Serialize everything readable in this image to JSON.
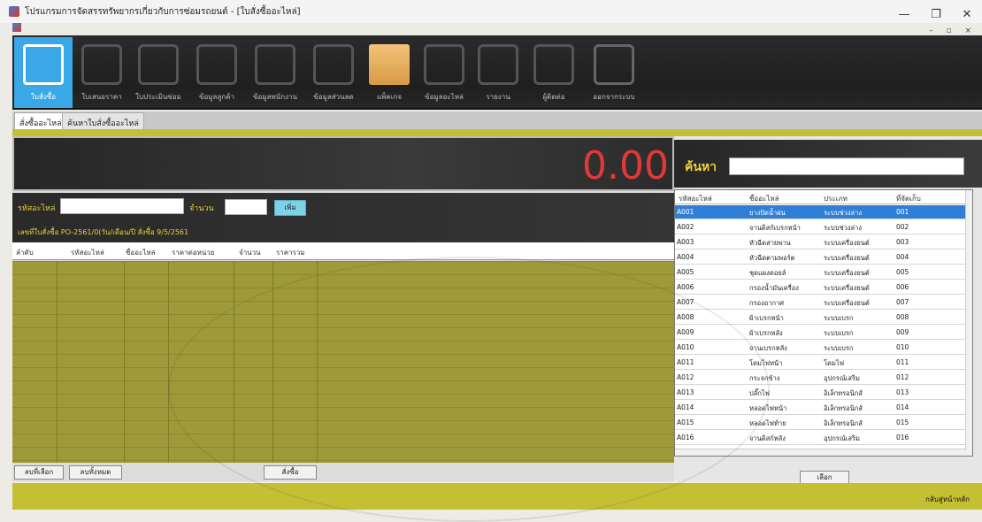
{
  "window": {
    "title": "โปรแกรมการจัดสรรทรัพยากรเกี่ยวกับการซ่อมรถยนต์ - [ใบสั่งซื้ออะไหล่]",
    "minimize": "—",
    "maximize": "❐",
    "close": "✕",
    "mdi_controls": "– ▫ ×"
  },
  "toolbar": {
    "items": [
      {
        "label": "ใบสั่งซื้อ",
        "icon": "calendar-check-icon"
      },
      {
        "label": "ใบเสนอราคา",
        "icon": "document-hand-icon"
      },
      {
        "label": "ใบประเมินซ่อม",
        "icon": "car-repair-icon"
      },
      {
        "label": "ข้อมูลลูกค้า",
        "icon": "customer-icon"
      },
      {
        "label": "ข้อมูลพนักงาน",
        "icon": "employee-card-icon"
      },
      {
        "label": "ข้อมูลส่วนลด",
        "icon": "sale-tag-icon"
      },
      {
        "label": "แพ็คเกจ",
        "icon": "boxes-icon"
      },
      {
        "label": "ข้อมูลอะไหล่",
        "icon": "parts-doc-icon"
      },
      {
        "label": "รายงาน",
        "icon": "report-icon"
      },
      {
        "label": "ผู้ติดต่อ",
        "icon": "contacts-icon"
      },
      {
        "label": "ออกจากระบบ",
        "icon": "exit-icon"
      }
    ]
  },
  "tabs": [
    "สั่งซื้ออะไหล่",
    "ค้นหาใบสั่งซื้ออะไหล่"
  ],
  "order": {
    "total": "0.00",
    "part_code_label": "รหัสอะไหล่",
    "qty_label": "จำนวน",
    "add_button": "เพิ่ม",
    "order_info": "เลขที่ใบสั่งซื้อ   PO-2561/0(วัน/เดือน/ปี สั่งซื้อ   9/5/2561",
    "columns": [
      "ลำดับ",
      "รหัสอะไหล่",
      "ชื่ออะไหล่",
      "ราคาต่อหน่วย",
      "จำนวน",
      "ราคารวม"
    ],
    "delete_selected": "ลบที่เลือก",
    "delete_all": "ลบทั้งหมด",
    "confirm": "สั่งซื้อ"
  },
  "search": {
    "label": "ค้นหา",
    "value": "",
    "columns": [
      "รหัสอะไหล่",
      "ชื่ออะไหล่",
      "ประเภท",
      "ที่จัดเก็บ"
    ],
    "rows": [
      {
        "code": "A001",
        "name": "ยางปัดน้ำฝน",
        "type": "ระบบช่วงล่าง",
        "loc": "001"
      },
      {
        "code": "A002",
        "name": "จานดิสก์เบรกหน้า",
        "type": "ระบบช่วงล่าง",
        "loc": "002"
      },
      {
        "code": "A003",
        "name": "หัวฉีดสายพาน",
        "type": "ระบบเครื่องยนต์",
        "loc": "003"
      },
      {
        "code": "A004",
        "name": "หัวฉีดตามพอร์ต",
        "type": "ระบบเครื่องยนต์",
        "loc": "004"
      },
      {
        "code": "A005",
        "name": "ชุดแผงคอยล์",
        "type": "ระบบเครื่องยนต์",
        "loc": "005"
      },
      {
        "code": "A006",
        "name": "กรองน้ำมันเครื่อง",
        "type": "ระบบเครื่องยนต์",
        "loc": "006"
      },
      {
        "code": "A007",
        "name": "กรองอากาศ",
        "type": "ระบบเครื่องยนต์",
        "loc": "007"
      },
      {
        "code": "A008",
        "name": "ผ้าเบรกหน้า",
        "type": "ระบบเบรก",
        "loc": "008"
      },
      {
        "code": "A009",
        "name": "ผ้าเบรกหลัง",
        "type": "ระบบเบรก",
        "loc": "009"
      },
      {
        "code": "A010",
        "name": "จานเบรกหลัง",
        "type": "ระบบเบรก",
        "loc": "010"
      },
      {
        "code": "A011",
        "name": "โคมไฟหน้า",
        "type": "โคมไฟ",
        "loc": "011"
      },
      {
        "code": "A012",
        "name": "กระจกข้าง",
        "type": "อุปกรณ์เสริม",
        "loc": "012"
      },
      {
        "code": "A013",
        "name": "ปลั๊กไฟ",
        "type": "อิเล็กทรอนิกส์",
        "loc": "013"
      },
      {
        "code": "A014",
        "name": "หลอดไฟหน้า",
        "type": "อิเล็กทรอนิกส์",
        "loc": "014"
      },
      {
        "code": "A015",
        "name": "หลอดไฟท้าย",
        "type": "อิเล็กทรอนิกส์",
        "loc": "015"
      },
      {
        "code": "A016",
        "name": "จานดิสก์หลัง",
        "type": "อุปกรณ์เสริม",
        "loc": "016"
      }
    ],
    "select_button": "เลือก"
  },
  "footer": {
    "back_link": "กลับสู่หน้าหลัก"
  }
}
